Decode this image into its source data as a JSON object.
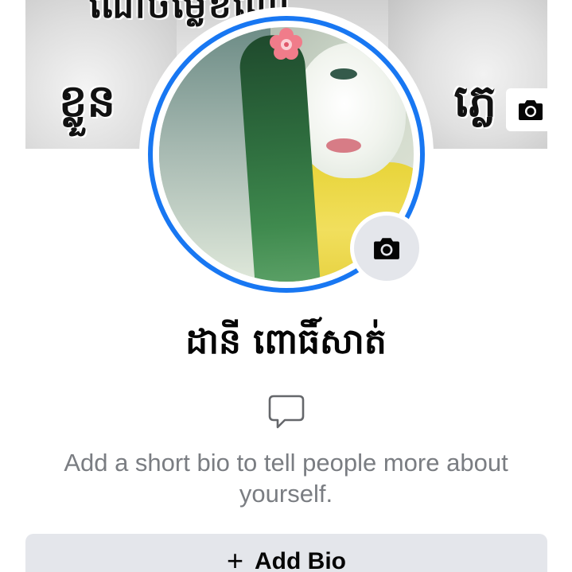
{
  "cover": {
    "text_top": "ណែចម្លេខណៃ",
    "text_left": "ខ្លួន",
    "text_right": "ភ្លេ"
  },
  "profile": {
    "name": "ដានី ពោធិ៍សាត់"
  },
  "bio": {
    "prompt": "Add a short bio to tell people more about yourself."
  },
  "actions": {
    "add_bio_icon": "+",
    "add_bio_label": "Add Bio"
  },
  "icons": {
    "cover_camera": "camera-icon",
    "avatar_camera": "camera-icon",
    "bio": "speech-bubble-icon"
  },
  "colors": {
    "ring": "#1877f2",
    "button_bg": "#e4e6eb",
    "secondary_text": "#7a7d82"
  }
}
